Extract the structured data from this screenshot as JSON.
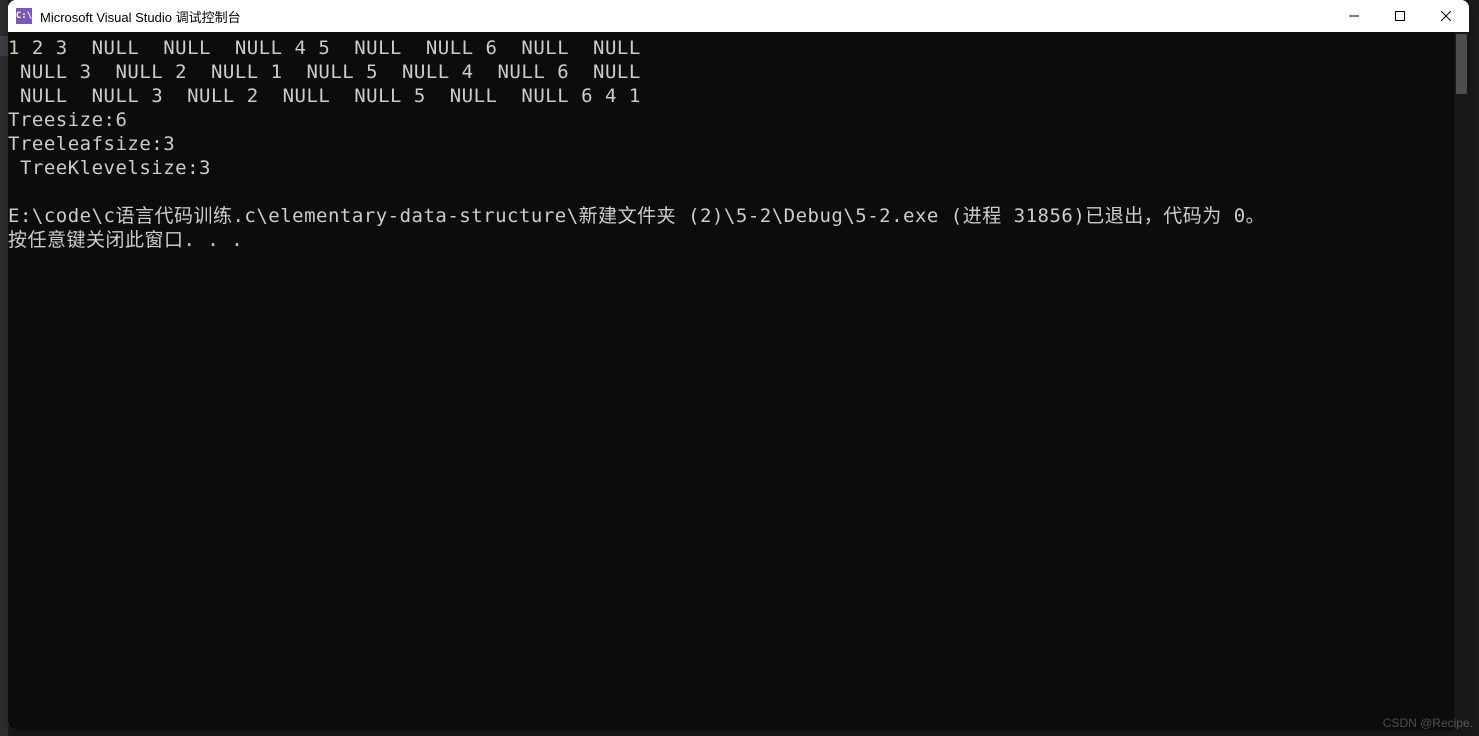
{
  "window": {
    "title": "Microsoft Visual Studio 调试控制台",
    "icon_label": "C:\\"
  },
  "console": {
    "lines": [
      "1 2 3  NULL  NULL  NULL 4 5  NULL  NULL 6  NULL  NULL",
      " NULL 3  NULL 2  NULL 1  NULL 5  NULL 4  NULL 6  NULL",
      " NULL  NULL 3  NULL 2  NULL  NULL 5  NULL  NULL 6 4 1",
      "Treesize:6",
      "Treeleafsize:3",
      " TreeKlevelsize:3",
      "",
      "E:\\code\\c语言代码训练.c\\elementary-data-structure\\新建文件夹 (2)\\5-2\\Debug\\5-2.exe (进程 31856)已退出，代码为 0。",
      "按任意键关闭此窗口. . ."
    ]
  },
  "watermark": "CSDN @Recipe."
}
